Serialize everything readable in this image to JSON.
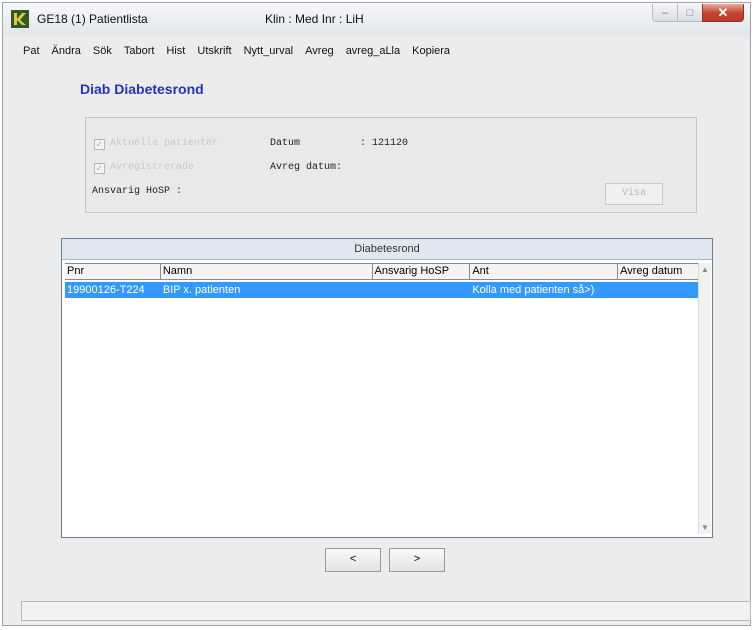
{
  "window": {
    "title": "GE18 (1) Patientlista",
    "info": "Klin : Med  Inr : LiH",
    "buttons": {
      "minimize": "–",
      "maximize": "□",
      "close": "✕"
    }
  },
  "menu": [
    "Pat",
    "Ändra",
    "Sök",
    "Tabort",
    "Hist",
    "Utskrift",
    "Nytt_urval",
    "Avreg",
    "avreg_aLla",
    "Kopiera"
  ],
  "panel": {
    "title": "Diab  Diabetesrond"
  },
  "filters": {
    "checkbox1_label": "Aktuella patienter",
    "checkbox2_label": "Avregistrerade",
    "datum_label": "Datum",
    "datum_value": ": 121120",
    "avreg_datum_label": "Avreg datum:",
    "ansvarig_label": "Ansvarig HoSP :",
    "visa_button": "Visa"
  },
  "list": {
    "caption": "Diabetesrond",
    "columns": [
      "Pnr",
      "Namn",
      "Ansvarig HoSP",
      "Ant",
      "Avreg datum"
    ],
    "rows": [
      [
        "19900126-T224",
        "BIP x. patienten",
        "",
        "Kolla med patienten så>)",
        ""
      ]
    ]
  },
  "nav": {
    "prev": "<",
    "next": ">"
  },
  "colors": {
    "title_blue": "#2233bb",
    "selection": "#3399ff"
  }
}
